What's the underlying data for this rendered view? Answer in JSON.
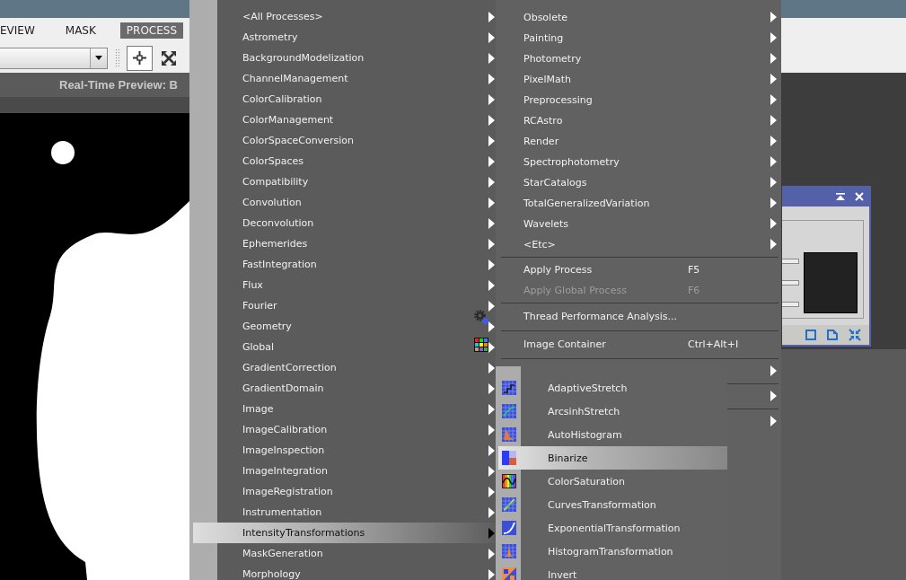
{
  "menubar": {
    "items": [
      {
        "label": "EVIEW",
        "selected": false
      },
      {
        "label": "MASK",
        "selected": false
      },
      {
        "label": "PROCESS",
        "selected": true
      }
    ]
  },
  "toolbar": {
    "buttons": [
      {
        "kind": "crosshair",
        "selected": true
      },
      {
        "kind": "fit",
        "selected": false
      }
    ]
  },
  "preview": {
    "title": "Real-Time Preview: B"
  },
  "process_menu": {
    "column_1": [
      {
        "label": "<All Processes>",
        "selected": false
      },
      {
        "label": "Astrometry",
        "selected": false
      },
      {
        "label": "BackgroundModelization",
        "selected": false
      },
      {
        "label": "ChannelManagement",
        "selected": false
      },
      {
        "label": "ColorCalibration",
        "selected": false
      },
      {
        "label": "ColorManagement",
        "selected": false
      },
      {
        "label": "ColorSpaceConversion",
        "selected": false
      },
      {
        "label": "ColorSpaces",
        "selected": false
      },
      {
        "label": "Compatibility",
        "selected": false
      },
      {
        "label": "Convolution",
        "selected": false
      },
      {
        "label": "Deconvolution",
        "selected": false
      },
      {
        "label": "Ephemerides",
        "selected": false
      },
      {
        "label": "FastIntegration",
        "selected": false
      },
      {
        "label": "Flux",
        "selected": false
      },
      {
        "label": "Fourier",
        "selected": false
      },
      {
        "label": "Geometry",
        "selected": false
      },
      {
        "label": "Global",
        "selected": false
      },
      {
        "label": "GradientCorrection",
        "selected": false
      },
      {
        "label": "GradientDomain",
        "selected": false
      },
      {
        "label": "Image",
        "selected": false
      },
      {
        "label": "ImageCalibration",
        "selected": false
      },
      {
        "label": "ImageInspection",
        "selected": false
      },
      {
        "label": "ImageIntegration",
        "selected": false
      },
      {
        "label": "ImageRegistration",
        "selected": false
      },
      {
        "label": "Instrumentation",
        "selected": false
      },
      {
        "label": "IntensityTransformations",
        "selected": true
      },
      {
        "label": "MaskGeneration",
        "selected": false
      },
      {
        "label": "Morphology",
        "selected": false
      }
    ],
    "column_2": [
      {
        "kind": "submenu",
        "label": "Obsolete",
        "selected": false,
        "disabled": false
      },
      {
        "kind": "submenu",
        "label": "Painting",
        "selected": false,
        "disabled": false
      },
      {
        "kind": "submenu",
        "label": "Photometry",
        "selected": false,
        "disabled": false
      },
      {
        "kind": "submenu",
        "label": "PixelMath",
        "selected": false,
        "disabled": false
      },
      {
        "kind": "submenu",
        "label": "Preprocessing",
        "selected": false,
        "disabled": false
      },
      {
        "kind": "submenu",
        "label": "RCAstro",
        "selected": false,
        "disabled": false
      },
      {
        "kind": "submenu",
        "label": "Render",
        "selected": false,
        "disabled": false
      },
      {
        "kind": "submenu",
        "label": "Spectrophotometry",
        "selected": false,
        "disabled": false
      },
      {
        "kind": "submenu",
        "label": "StarCatalogs",
        "selected": false,
        "disabled": false
      },
      {
        "kind": "submenu",
        "label": "TotalGeneralizedVariation",
        "selected": false,
        "disabled": false
      },
      {
        "kind": "submenu",
        "label": "Wavelets",
        "selected": false,
        "disabled": false
      },
      {
        "kind": "submenu",
        "label": "<Etc>",
        "selected": false,
        "disabled": false
      },
      {
        "kind": "separator"
      },
      {
        "kind": "command",
        "label": "Apply Process",
        "shortcut": "F5",
        "selected": false,
        "disabled": false
      },
      {
        "kind": "command",
        "label": "Apply Global Process",
        "shortcut": "F6",
        "selected": false,
        "disabled": true
      },
      {
        "kind": "separator"
      },
      {
        "kind": "analysis",
        "label": "Thread Performance Analysis...",
        "selected": false,
        "disabled": false
      },
      {
        "kind": "separator"
      },
      {
        "kind": "container",
        "label": "Image Container",
        "shortcut": "Ctrl+Alt+I",
        "selected": false,
        "disabled": false
      },
      {
        "kind": "separator"
      },
      {
        "kind": "submenu",
        "selected": false,
        "disabled": false
      },
      {
        "kind": "separator"
      },
      {
        "kind": "submenu",
        "selected": false,
        "disabled": false
      },
      {
        "kind": "separator"
      },
      {
        "kind": "submenu",
        "selected": false,
        "disabled": false
      }
    ]
  },
  "submenu": {
    "items": [
      {
        "kind": "stretch",
        "label": "AdaptiveStretch",
        "selected": false
      },
      {
        "kind": "curve",
        "label": "ArcsinhStretch",
        "selected": false
      },
      {
        "kind": "histogram",
        "label": "AutoHistogram",
        "selected": false
      },
      {
        "kind": "split",
        "label": "Binarize",
        "selected": true
      },
      {
        "kind": "saturation",
        "label": "ColorSaturation",
        "selected": false
      },
      {
        "kind": "curves",
        "label": "CurvesTransformation",
        "selected": false
      },
      {
        "kind": "exponent",
        "label": "ExponentialTransformation",
        "selected": false
      },
      {
        "kind": "peak",
        "label": "HistogramTransformation",
        "selected": false
      },
      {
        "kind": "invert",
        "label": "Invert",
        "selected": false
      }
    ]
  }
}
